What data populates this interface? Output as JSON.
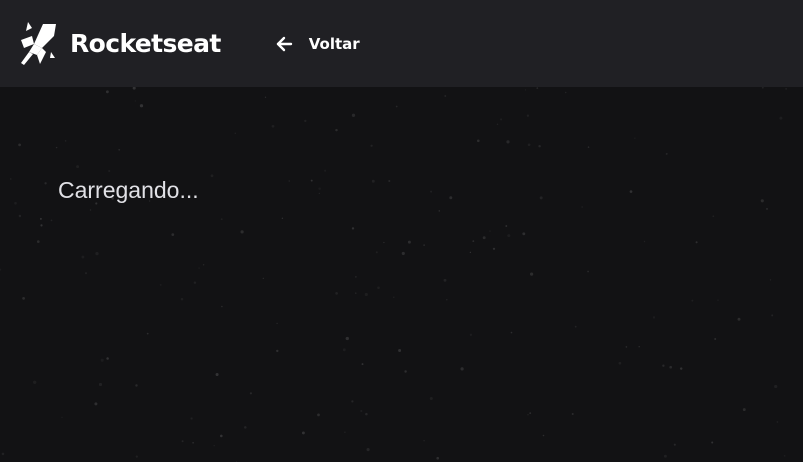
{
  "header": {
    "logo": {
      "icon": "rocket-icon",
      "text": "Rocketseat"
    },
    "back": {
      "icon": "arrow-left-icon",
      "label": "Voltar"
    }
  },
  "main": {
    "status_text": "Carregando..."
  },
  "colors": {
    "header_bg": "#202024",
    "page_bg": "#121214",
    "text": "#e1e1e6"
  }
}
